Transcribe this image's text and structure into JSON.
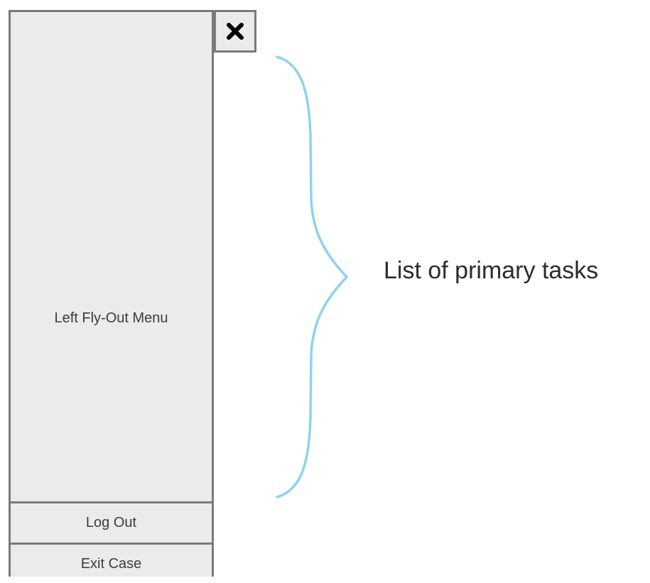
{
  "menu": {
    "title": "Left Fly-Out Menu",
    "footer_items": [
      {
        "label": "Log Out"
      },
      {
        "label": "Exit Case"
      }
    ],
    "close_icon": "close-x-icon"
  },
  "annotation": {
    "label": "List of primary tasks",
    "brace_color": "#8fd1f2"
  }
}
